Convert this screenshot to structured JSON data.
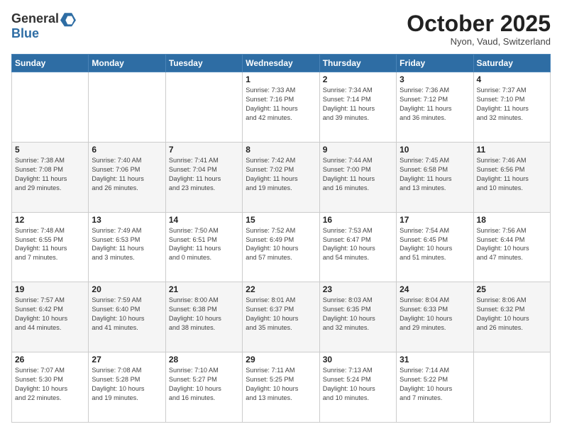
{
  "header": {
    "logo_line1": "General",
    "logo_line2": "Blue",
    "month": "October 2025",
    "location": "Nyon, Vaud, Switzerland"
  },
  "weekdays": [
    "Sunday",
    "Monday",
    "Tuesday",
    "Wednesday",
    "Thursday",
    "Friday",
    "Saturday"
  ],
  "weeks": [
    [
      {
        "day": "",
        "info": ""
      },
      {
        "day": "",
        "info": ""
      },
      {
        "day": "",
        "info": ""
      },
      {
        "day": "1",
        "info": "Sunrise: 7:33 AM\nSunset: 7:16 PM\nDaylight: 11 hours\nand 42 minutes."
      },
      {
        "day": "2",
        "info": "Sunrise: 7:34 AM\nSunset: 7:14 PM\nDaylight: 11 hours\nand 39 minutes."
      },
      {
        "day": "3",
        "info": "Sunrise: 7:36 AM\nSunset: 7:12 PM\nDaylight: 11 hours\nand 36 minutes."
      },
      {
        "day": "4",
        "info": "Sunrise: 7:37 AM\nSunset: 7:10 PM\nDaylight: 11 hours\nand 32 minutes."
      }
    ],
    [
      {
        "day": "5",
        "info": "Sunrise: 7:38 AM\nSunset: 7:08 PM\nDaylight: 11 hours\nand 29 minutes."
      },
      {
        "day": "6",
        "info": "Sunrise: 7:40 AM\nSunset: 7:06 PM\nDaylight: 11 hours\nand 26 minutes."
      },
      {
        "day": "7",
        "info": "Sunrise: 7:41 AM\nSunset: 7:04 PM\nDaylight: 11 hours\nand 23 minutes."
      },
      {
        "day": "8",
        "info": "Sunrise: 7:42 AM\nSunset: 7:02 PM\nDaylight: 11 hours\nand 19 minutes."
      },
      {
        "day": "9",
        "info": "Sunrise: 7:44 AM\nSunset: 7:00 PM\nDaylight: 11 hours\nand 16 minutes."
      },
      {
        "day": "10",
        "info": "Sunrise: 7:45 AM\nSunset: 6:58 PM\nDaylight: 11 hours\nand 13 minutes."
      },
      {
        "day": "11",
        "info": "Sunrise: 7:46 AM\nSunset: 6:56 PM\nDaylight: 11 hours\nand 10 minutes."
      }
    ],
    [
      {
        "day": "12",
        "info": "Sunrise: 7:48 AM\nSunset: 6:55 PM\nDaylight: 11 hours\nand 7 minutes."
      },
      {
        "day": "13",
        "info": "Sunrise: 7:49 AM\nSunset: 6:53 PM\nDaylight: 11 hours\nand 3 minutes."
      },
      {
        "day": "14",
        "info": "Sunrise: 7:50 AM\nSunset: 6:51 PM\nDaylight: 11 hours\nand 0 minutes."
      },
      {
        "day": "15",
        "info": "Sunrise: 7:52 AM\nSunset: 6:49 PM\nDaylight: 10 hours\nand 57 minutes."
      },
      {
        "day": "16",
        "info": "Sunrise: 7:53 AM\nSunset: 6:47 PM\nDaylight: 10 hours\nand 54 minutes."
      },
      {
        "day": "17",
        "info": "Sunrise: 7:54 AM\nSunset: 6:45 PM\nDaylight: 10 hours\nand 51 minutes."
      },
      {
        "day": "18",
        "info": "Sunrise: 7:56 AM\nSunset: 6:44 PM\nDaylight: 10 hours\nand 47 minutes."
      }
    ],
    [
      {
        "day": "19",
        "info": "Sunrise: 7:57 AM\nSunset: 6:42 PM\nDaylight: 10 hours\nand 44 minutes."
      },
      {
        "day": "20",
        "info": "Sunrise: 7:59 AM\nSunset: 6:40 PM\nDaylight: 10 hours\nand 41 minutes."
      },
      {
        "day": "21",
        "info": "Sunrise: 8:00 AM\nSunset: 6:38 PM\nDaylight: 10 hours\nand 38 minutes."
      },
      {
        "day": "22",
        "info": "Sunrise: 8:01 AM\nSunset: 6:37 PM\nDaylight: 10 hours\nand 35 minutes."
      },
      {
        "day": "23",
        "info": "Sunrise: 8:03 AM\nSunset: 6:35 PM\nDaylight: 10 hours\nand 32 minutes."
      },
      {
        "day": "24",
        "info": "Sunrise: 8:04 AM\nSunset: 6:33 PM\nDaylight: 10 hours\nand 29 minutes."
      },
      {
        "day": "25",
        "info": "Sunrise: 8:06 AM\nSunset: 6:32 PM\nDaylight: 10 hours\nand 26 minutes."
      }
    ],
    [
      {
        "day": "26",
        "info": "Sunrise: 7:07 AM\nSunset: 5:30 PM\nDaylight: 10 hours\nand 22 minutes."
      },
      {
        "day": "27",
        "info": "Sunrise: 7:08 AM\nSunset: 5:28 PM\nDaylight: 10 hours\nand 19 minutes."
      },
      {
        "day": "28",
        "info": "Sunrise: 7:10 AM\nSunset: 5:27 PM\nDaylight: 10 hours\nand 16 minutes."
      },
      {
        "day": "29",
        "info": "Sunrise: 7:11 AM\nSunset: 5:25 PM\nDaylight: 10 hours\nand 13 minutes."
      },
      {
        "day": "30",
        "info": "Sunrise: 7:13 AM\nSunset: 5:24 PM\nDaylight: 10 hours\nand 10 minutes."
      },
      {
        "day": "31",
        "info": "Sunrise: 7:14 AM\nSunset: 5:22 PM\nDaylight: 10 hours\nand 7 minutes."
      },
      {
        "day": "",
        "info": ""
      }
    ]
  ]
}
